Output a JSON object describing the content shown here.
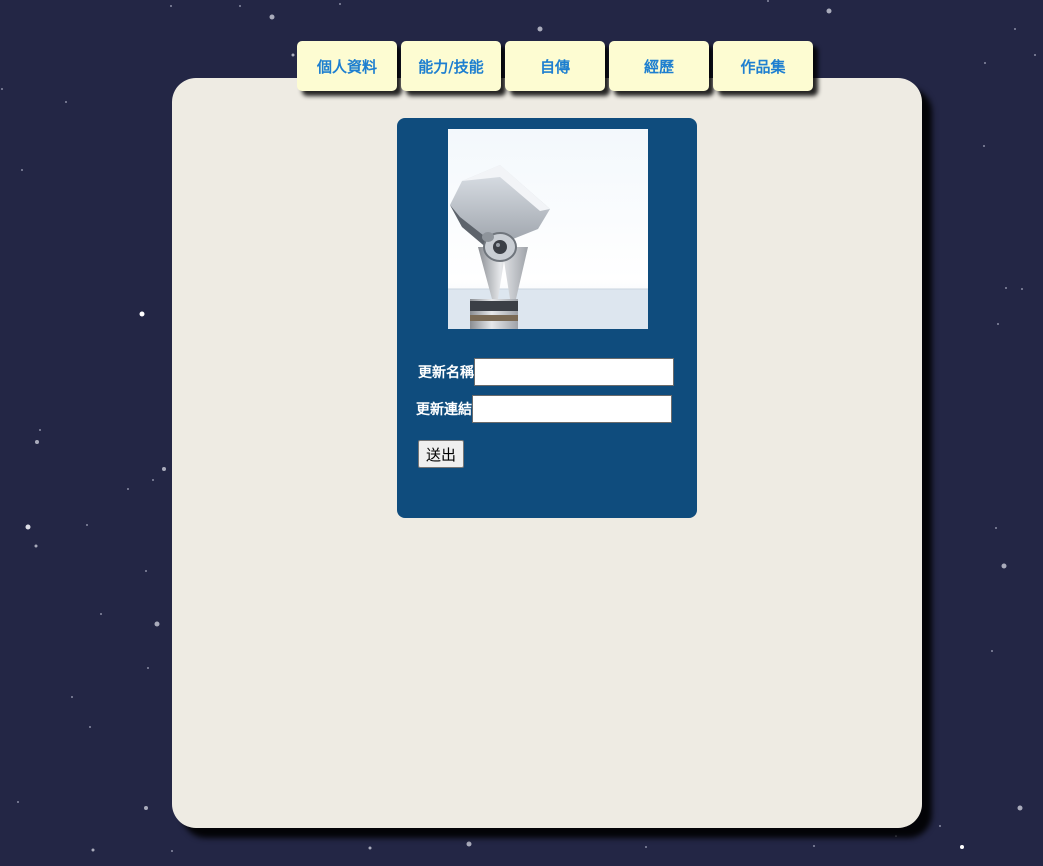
{
  "colors": {
    "background": "#232645",
    "panel": "#eeebe3",
    "tab_background": "#fdfcd2",
    "tab_text": "#1e7fd0",
    "card": "#0f4c7d",
    "card_text": "#ffffff"
  },
  "nav": {
    "tabs": [
      {
        "label": "個人資料"
      },
      {
        "label": "能力/技能"
      },
      {
        "label": "自傳"
      },
      {
        "label": "經歷"
      },
      {
        "label": "作品集"
      }
    ]
  },
  "card": {
    "image_icon": "coin-operated-binoculars-photo",
    "form": {
      "name_label": "更新名稱",
      "name_value": "",
      "link_label": "更新連結",
      "link_value": "",
      "submit_label": "送出"
    }
  }
}
